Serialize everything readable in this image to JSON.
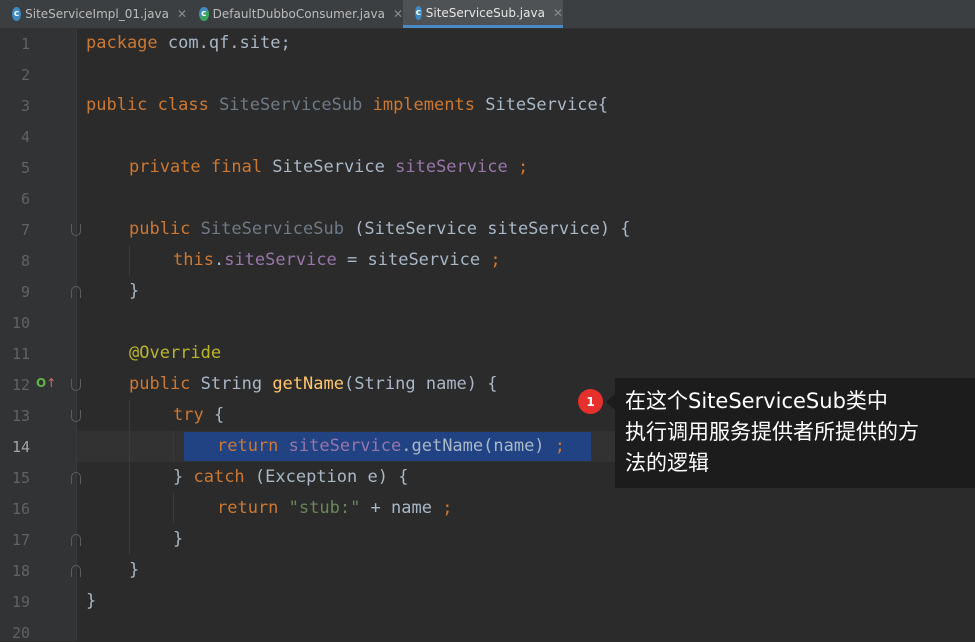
{
  "tabs": [
    {
      "label": "SiteServiceImpl_01.java",
      "close": "✕"
    },
    {
      "label": "DefaultDubboConsumer.java",
      "close": "✕"
    },
    {
      "label": "SiteServiceSub.java",
      "close": "✕"
    }
  ],
  "editor": {
    "line_numbers": [
      "1",
      "2",
      "3",
      "4",
      "5",
      "6",
      "7",
      "8",
      "9",
      "10",
      "11",
      "12",
      "13",
      "14",
      "15",
      "16",
      "17",
      "18",
      "19",
      "20"
    ],
    "current_line": "14",
    "code": {
      "l1_kw": "package",
      "l1_rest": " com.qf.site;",
      "l3_kw1": "public class ",
      "l3_cls": "SiteServiceSub",
      "l3_kw2": " implements ",
      "l3_rest": "SiteService{",
      "l5_kw": "private final ",
      "l5_type": "SiteService ",
      "l5_fld": "siteService",
      "l5_semi": " ;",
      "l7_kw": "public ",
      "l7_cls": "SiteServiceSub",
      "l7_rest": " (SiteService siteService) {",
      "l8_kw": "this",
      "l8_dot": ".",
      "l8_fld": "siteService",
      "l8_rest": " = siteService ",
      "l8_semi": ";",
      "l9": "}",
      "l11_ann": "@Override",
      "l12_kw": "public ",
      "l12_type": "String ",
      "l12_fn": "getName",
      "l12_rest": "(String name) {",
      "l13_kw": "try ",
      "l13_rest": "{",
      "l14_kw": "return ",
      "l14_fld": "siteService",
      "l14_rest": ".getName(name) ",
      "l14_semi": ";",
      "l15_a": "} ",
      "l15_kw": "catch ",
      "l15_rest": "(Exception e) {",
      "l16_kw": "return ",
      "l16_str": "\"stub:\"",
      "l16_rest": " + name ",
      "l16_semi": ";",
      "l17": "}",
      "l18": "}",
      "l19": "}"
    },
    "gutter_icon": {
      "overrides": "O",
      "arrow": "↑"
    }
  },
  "annotation": {
    "badge": "1",
    "lines": [
      "在这个SiteServiceSub类中",
      "执行调用服务提供者所提供的方",
      "法的逻辑"
    ]
  }
}
